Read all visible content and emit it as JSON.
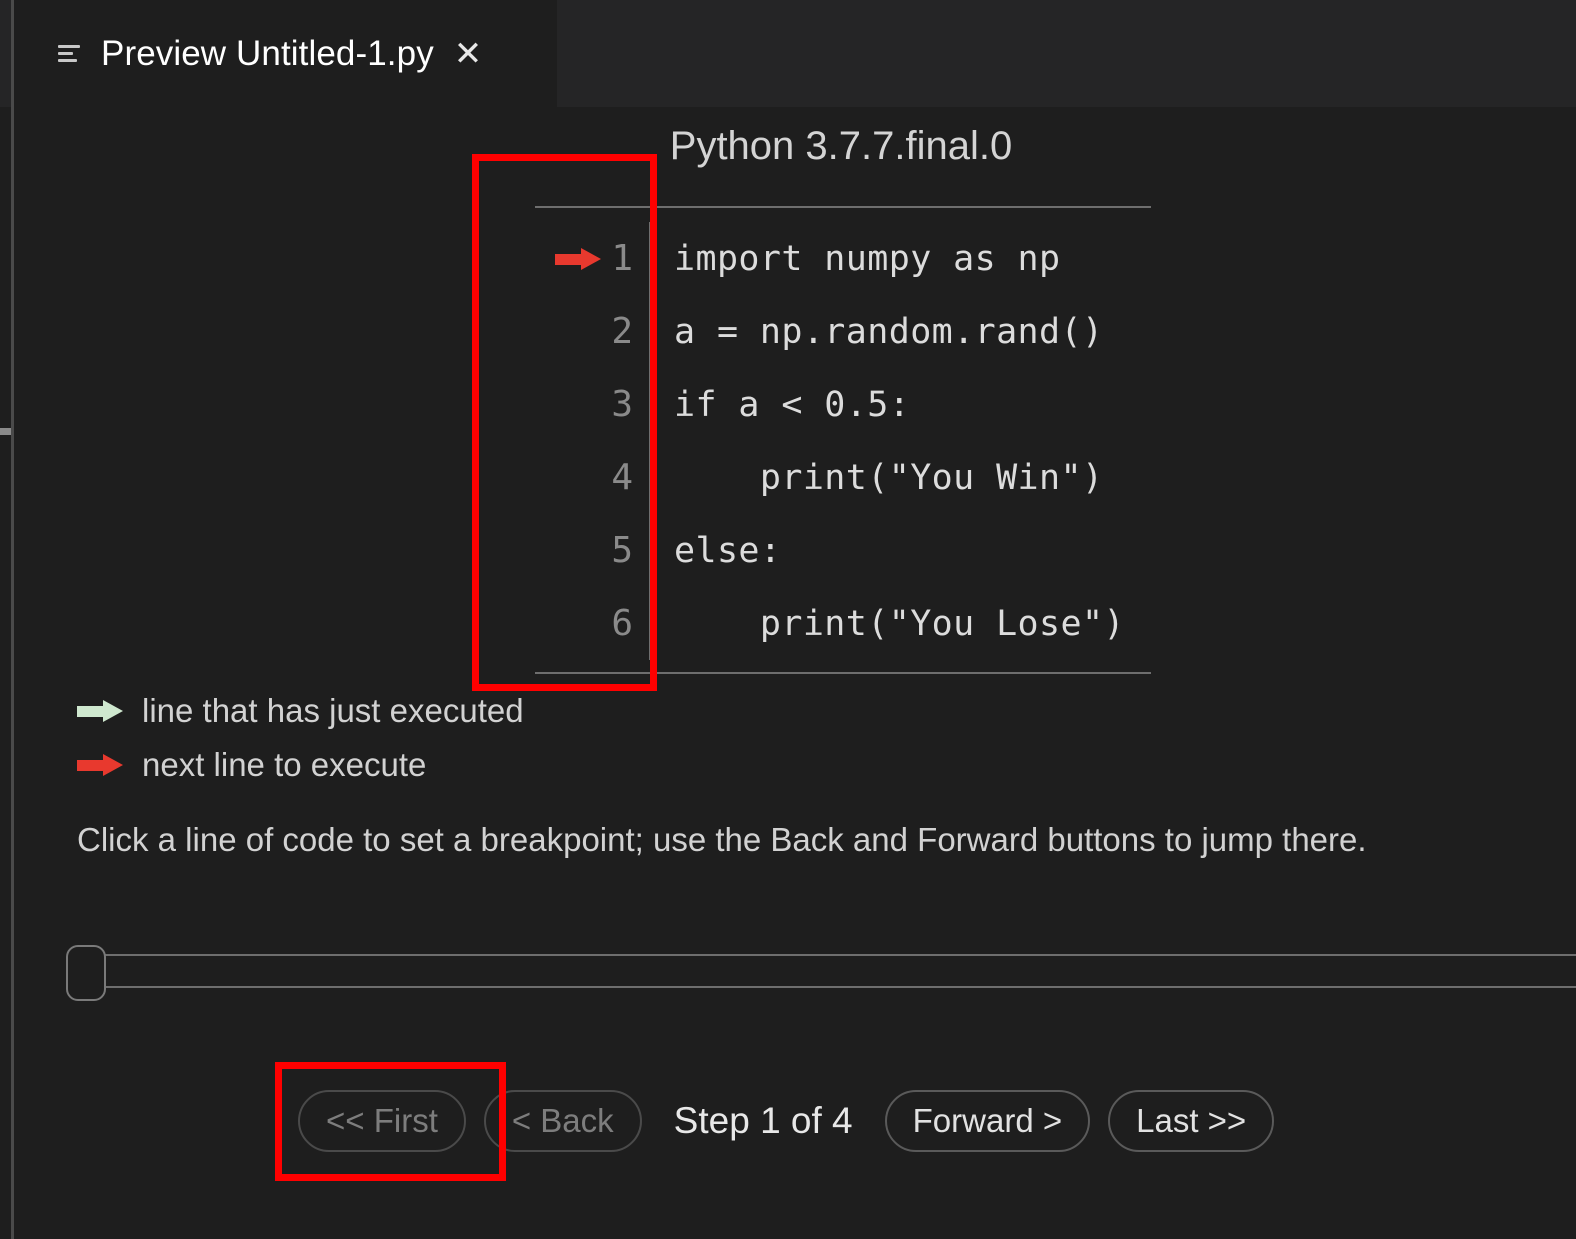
{
  "window": {
    "tab": {
      "icon": "list-lines-icon",
      "title": "Preview Untitled-1.py",
      "close": "✕"
    }
  },
  "header": {
    "python_version": "Python 3.7.7.final.0"
  },
  "code": {
    "lines": [
      {
        "num": "1",
        "text": "import numpy as np",
        "marker": "next"
      },
      {
        "num": "2",
        "text": "a = np.random.rand()",
        "marker": "none"
      },
      {
        "num": "3",
        "text": "if a < 0.5:",
        "marker": "none"
      },
      {
        "num": "4",
        "text": "    print(\"You Win\")",
        "marker": "none"
      },
      {
        "num": "5",
        "text": "else:",
        "marker": "none"
      },
      {
        "num": "6",
        "text": "    print(\"You Lose\")",
        "marker": "none"
      }
    ]
  },
  "legend": {
    "executed": {
      "icon": "green-arrow-icon",
      "label": "line that has just executed"
    },
    "next": {
      "icon": "red-arrow-icon",
      "label": "next line to execute"
    }
  },
  "instruction": "Click a line of code to set a breakpoint; use the Back and Forward buttons to jump there.",
  "slider": {
    "value": "0",
    "min": "0",
    "max": "3"
  },
  "nav": {
    "first": "<< First",
    "back": "< Back",
    "step": "Step 1 of 4",
    "forward": "Forward >",
    "last": "Last >>"
  },
  "colors": {
    "background": "#1e1e1e",
    "tabbar": "#252526",
    "annotation": "#ff0000",
    "next_arrow": "#e8392e",
    "executed_arrow": "#cfe8cf",
    "text": "#d2d2d2",
    "line_number": "#8a8a8a"
  },
  "annotations": [
    {
      "name": "gutter-highlight"
    },
    {
      "name": "first-button-highlight"
    }
  ]
}
